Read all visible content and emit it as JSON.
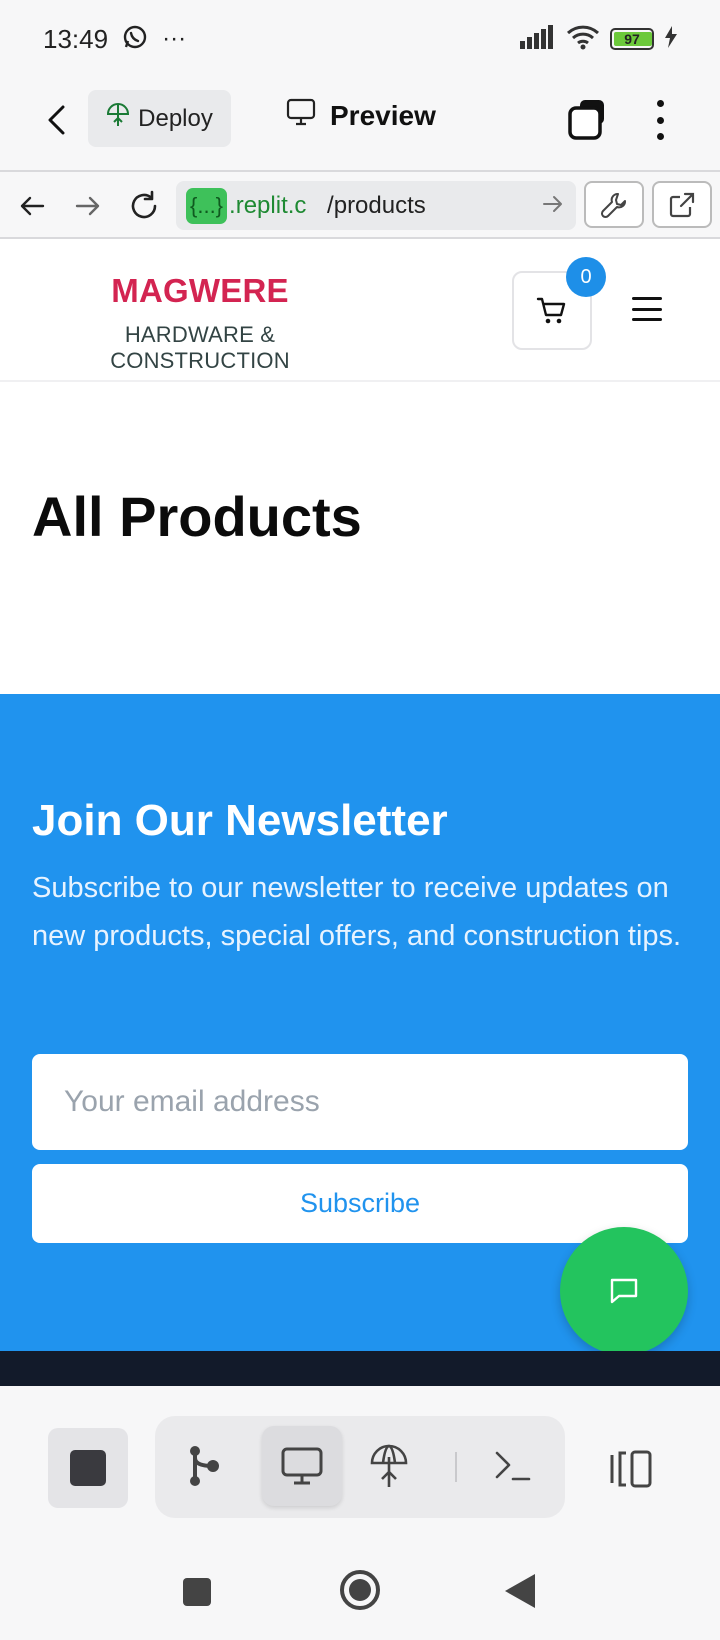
{
  "status_bar": {
    "time": "13:49",
    "more_indicator": "···",
    "battery_level": "97",
    "icons": [
      "whatsapp-icon",
      "signal-icon",
      "wifi-icon",
      "battery-icon",
      "charging-icon"
    ]
  },
  "top_bar": {
    "deploy_label": "Deploy",
    "preview_label": "Preview"
  },
  "url_bar": {
    "badge": "{...}",
    "host": ".replit.c",
    "path": "/products"
  },
  "site": {
    "brand_name": "MAGWERE",
    "brand_subtitle": "HARDWARE & CONSTRUCTION",
    "cart_count": "0",
    "page_title": "All Products",
    "newsletter": {
      "title": "Join Our Newsletter",
      "text": "Subscribe to our newsletter to receive updates on new products, special offers, and construction tips.",
      "email_placeholder": "Your email address",
      "subscribe_label": "Subscribe"
    }
  },
  "colors": {
    "brand_red": "#d32451",
    "newsletter_blue": "#2093ee",
    "chat_green": "#23c45e",
    "url_green": "#1f8a33"
  }
}
